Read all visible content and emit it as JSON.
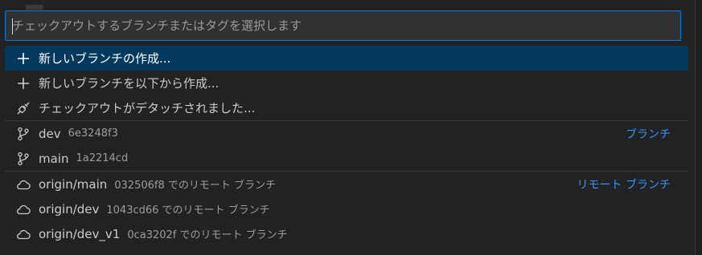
{
  "picker": {
    "placeholder": "チェックアウトするブランチまたはタグを選択します"
  },
  "actions": [
    {
      "label": "新しいブランチの作成...",
      "icon": "plus-icon"
    },
    {
      "label": "新しいブランチを以下から作成...",
      "icon": "plus-icon"
    },
    {
      "label": "チェックアウトがデタッチされました...",
      "icon": "debug-disconnect-icon"
    }
  ],
  "branches": {
    "group_label": "ブランチ",
    "items": [
      {
        "name": "dev",
        "hash": "6e3248f3",
        "icon": "git-branch-icon"
      },
      {
        "name": "main",
        "hash": "1a2214cd",
        "icon": "git-branch-icon"
      }
    ]
  },
  "remotes": {
    "group_label": "リモート ブランチ",
    "items": [
      {
        "name": "origin/main",
        "desc": "032506f8 でのリモート ブランチ",
        "icon": "cloud-icon"
      },
      {
        "name": "origin/dev",
        "desc": "1043cd66 でのリモート ブランチ",
        "icon": "cloud-icon"
      },
      {
        "name": "origin/dev_v1",
        "desc": "0ca3202f でのリモート ブランチ",
        "icon": "cloud-icon"
      }
    ]
  },
  "colors": {
    "accent": "#0078d4",
    "active_row": "#04395e",
    "group_label": "#3794ff"
  }
}
